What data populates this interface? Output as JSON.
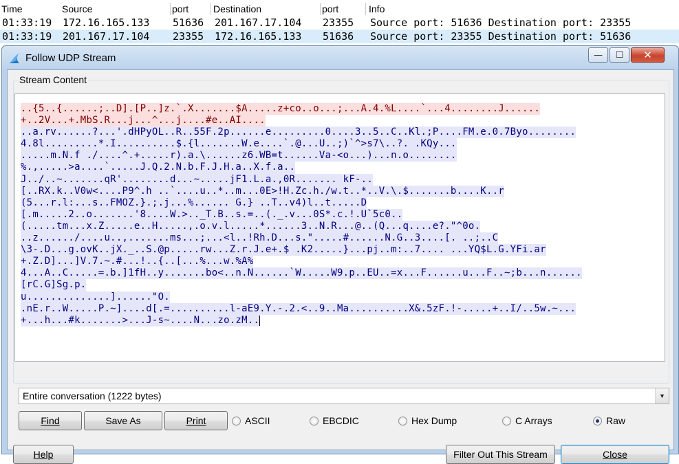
{
  "packet_list": {
    "columns": [
      "Time",
      "Source",
      "port",
      "Destination",
      "port",
      "Info"
    ],
    "rows": [
      {
        "time": "01:33:19",
        "source": "172.16.165.133",
        "sport": "51636",
        "destination": "201.167.17.104",
        "dport": "23355",
        "info": "Source port: 51636   Destination port: 23355"
      },
      {
        "time": "01:33:19",
        "source": "201.167.17.104",
        "sport": "23355",
        "destination": "172.16.165.133",
        "dport": "51636",
        "info": "Source port: 23355   Destination port: 51636"
      }
    ]
  },
  "dialog": {
    "title": "Follow UDP Stream",
    "window_buttons": {
      "minimize": "—",
      "maximize": "☐",
      "close": "✕"
    },
    "group_label": "Stream Content",
    "stream_lines": [
      {
        "dir": "client",
        "text": "..{5..{......;..D].[P..]z.`.X.......$A.....z+co..o...;...A.4.%L....`...4........J......"
      },
      {
        "dir": "client",
        "text": "+..2V...+.MbS.R...j...^...j....#e..AI...."
      },
      {
        "dir": "server",
        "text": "..a.rv......?...'.dHPyOL..R..55F.2p......e.........0....3..5..C..Kl.;P....FM.e.0.7Byo........"
      },
      {
        "dir": "server",
        "text": "4.8l.........*.I..........$.{l.......W.e....`.@...U..;)`^>s7\\..?. .KQy..."
      },
      {
        "dir": "server",
        "text": ".....m.N.f ./....^.+.....r).a.\\......z6.WB=t......Va-<o...)...n.o........"
      },
      {
        "dir": "server",
        "text": "%.,.....>a....`.....J.Q.2.N.b.F.J.H.a..X.f.a.."
      },
      {
        "dir": "server",
        "text": "J../..~.......qR'........d...~.....jF1.L.a.,0R....... kF-.."
      },
      {
        "dir": "server",
        "text": "[..RX.k..V0w<....P9^.h ..`....u..*..m...0E>!H.Zc.h./w.t..*..V.\\.$.......b....K..r"
      },
      {
        "dir": "server",
        "text": "(5...r.l:...s..FMOZ.}.;.j...%...... G.} ..T..v4)l..t.....D"
      },
      {
        "dir": "server",
        "text": "[.m.....2..o.......'8....W.>.._T.B..s.=..(._.v...0S*.c.!.U`5c0.."
      },
      {
        "dir": "server",
        "text": "(.....tm...x.Z.....e..H.....,.o.v.l.....*......3..N.R...@..(Q...q....e?.\"^0o."
      },
      {
        "dir": "server",
        "text": "..z....../....u..,.......ms...;...<l..!Rh.D...s.\".....#......N.G..3....[. ..;..C"
      },
      {
        "dir": "server",
        "text": "\\3-.D...g.ovK..jX._..S.@p.....rw...Z.r.J.e+.$ .K2.....}...pj..m:..7.... ...YQ$L.G.YFi.ar"
      },
      {
        "dir": "server",
        "text": "+.Z.D]...]V.7.~.#...!..{..[...%...w.%A%"
      },
      {
        "dir": "server",
        "text": "4...A..C.....=.b.]1fH..y.......bo<..n.N......`W.....W9.p..EU..=x...F......u...F..~;b...n......"
      },
      {
        "dir": "server",
        "text": "[rC.G]Sg.p."
      },
      {
        "dir": "server",
        "text": "u..............]......\"O."
      },
      {
        "dir": "server",
        "text": ".nE.r..W.....P.~]....d[.=..........l-aE9.Y.-.2.<..9..Ma..........X&.5zF.!-.....+..I/..5w.~..."
      },
      {
        "dir": "server",
        "text": "+...h...#k.......>...J-s~....N...zo.zM.."
      }
    ],
    "conversation_select": "Entire conversation (1222 bytes)",
    "buttons": {
      "find": "Find",
      "save_as": "Save As",
      "print": "Print",
      "help": "Help",
      "filter_out": "Filter Out This Stream",
      "close": "Close"
    },
    "formats": [
      {
        "label": "ASCII",
        "selected": false
      },
      {
        "label": "EBCDIC",
        "selected": false
      },
      {
        "label": "Hex Dump",
        "selected": false
      },
      {
        "label": "C Arrays",
        "selected": false
      },
      {
        "label": "Raw",
        "selected": true
      }
    ],
    "icons": {
      "title_icon": "wireshark-fin-icon",
      "combo_arrow": "▼"
    }
  },
  "colors": {
    "client_bg": "#fbdede",
    "client_fg": "#7f0000",
    "server_bg": "#e6e6fa",
    "server_fg": "#000080",
    "selected_row": "#d9ecfb"
  }
}
